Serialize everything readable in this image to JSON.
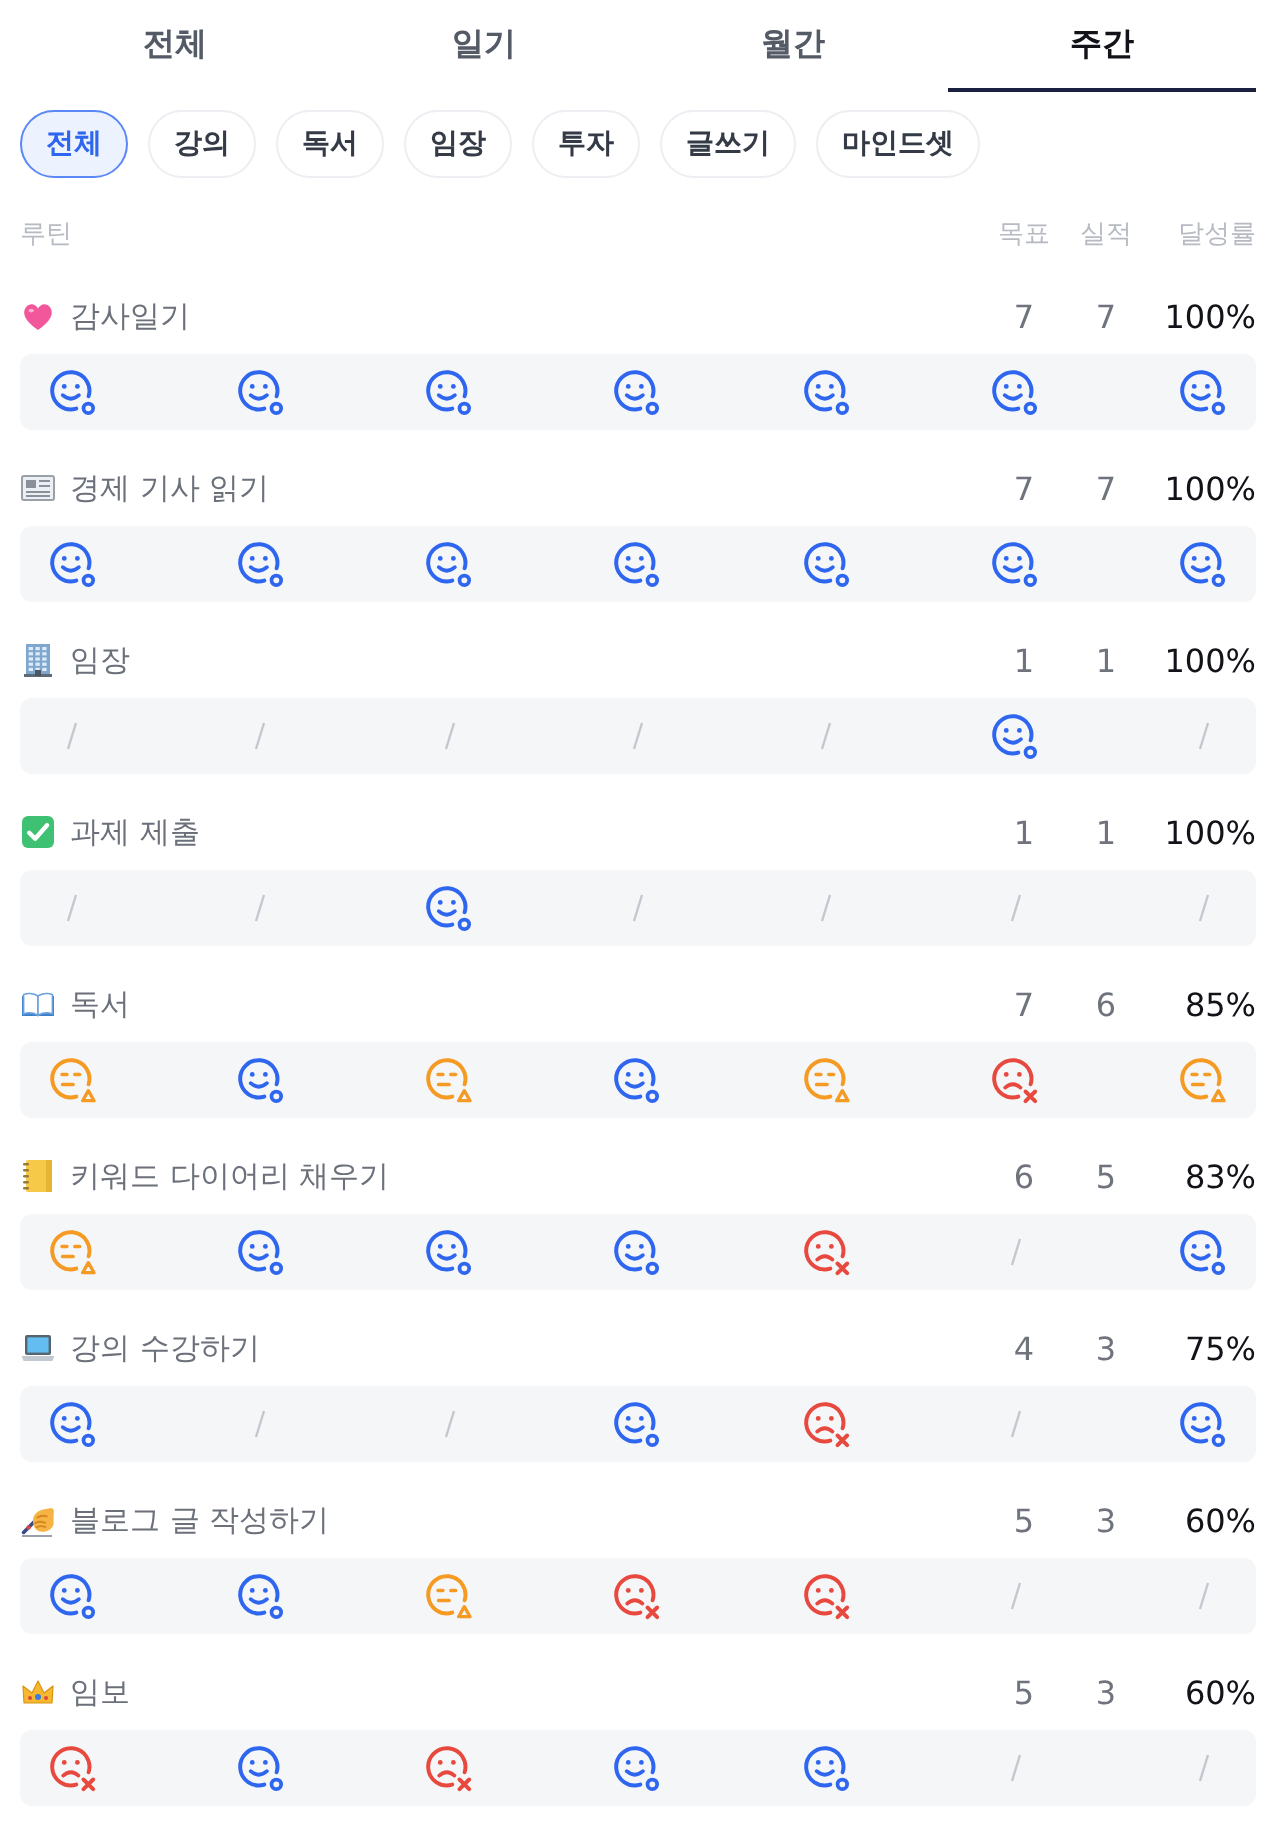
{
  "tabs": [
    {
      "label": "전체",
      "selected": false
    },
    {
      "label": "일기",
      "selected": false
    },
    {
      "label": "월간",
      "selected": false
    },
    {
      "label": "주간",
      "selected": true
    }
  ],
  "filters": [
    {
      "label": "전체",
      "selected": true
    },
    {
      "label": "강의",
      "selected": false
    },
    {
      "label": "독서",
      "selected": false
    },
    {
      "label": "임장",
      "selected": false
    },
    {
      "label": "투자",
      "selected": false
    },
    {
      "label": "글쓰기",
      "selected": false
    },
    {
      "label": "마인드셋",
      "selected": false
    }
  ],
  "table": {
    "columns": [
      "루틴",
      "목표",
      "실적",
      "달성률"
    ],
    "rows": [
      {
        "name": "감사일기",
        "goal": "7",
        "actual": "7",
        "rate": "100%",
        "days": [
          {
            "kind": "done"
          },
          {
            "kind": "done"
          },
          {
            "kind": "done"
          },
          {
            "kind": "done"
          },
          {
            "kind": "done"
          },
          {
            "kind": "done"
          },
          {
            "kind": "done"
          }
        ]
      },
      {
        "name": "경제 기사 읽기",
        "goal": "7",
        "actual": "7",
        "rate": "100%",
        "days": [
          {
            "kind": "done"
          },
          {
            "kind": "done"
          },
          {
            "kind": "done"
          },
          {
            "kind": "done"
          },
          {
            "kind": "done"
          },
          {
            "kind": "done"
          },
          {
            "kind": "done"
          }
        ]
      },
      {
        "name": "임장",
        "goal": "1",
        "actual": "1",
        "rate": "100%",
        "days": [
          {
            "kind": "none"
          },
          {
            "kind": "none"
          },
          {
            "kind": "none"
          },
          {
            "kind": "none"
          },
          {
            "kind": "none"
          },
          {
            "kind": "done"
          },
          {
            "kind": "none"
          }
        ]
      },
      {
        "name": "과제 제출",
        "goal": "1",
        "actual": "1",
        "rate": "100%",
        "days": [
          {
            "kind": "none"
          },
          {
            "kind": "none"
          },
          {
            "kind": "done"
          },
          {
            "kind": "none"
          },
          {
            "kind": "none"
          },
          {
            "kind": "none"
          },
          {
            "kind": "none"
          }
        ]
      },
      {
        "name": "독서",
        "goal": "7",
        "actual": "6",
        "rate": "85%",
        "days": [
          {
            "kind": "partial"
          },
          {
            "kind": "done"
          },
          {
            "kind": "partial"
          },
          {
            "kind": "done"
          },
          {
            "kind": "partial"
          },
          {
            "kind": "missed"
          },
          {
            "kind": "partial"
          }
        ]
      },
      {
        "name": "키워드 다이어리 채우기",
        "goal": "6",
        "actual": "5",
        "rate": "83%",
        "days": [
          {
            "kind": "partial"
          },
          {
            "kind": "done"
          },
          {
            "kind": "done"
          },
          {
            "kind": "done"
          },
          {
            "kind": "missed"
          },
          {
            "kind": "none"
          },
          {
            "kind": "done"
          }
        ]
      },
      {
        "name": "강의 수강하기",
        "goal": "4",
        "actual": "3",
        "rate": "75%",
        "days": [
          {
            "kind": "done"
          },
          {
            "kind": "none"
          },
          {
            "kind": "none"
          },
          {
            "kind": "done"
          },
          {
            "kind": "missed"
          },
          {
            "kind": "none"
          },
          {
            "kind": "done"
          }
        ]
      },
      {
        "name": "블로그 글 작성하기",
        "goal": "5",
        "actual": "3",
        "rate": "60%",
        "days": [
          {
            "kind": "done"
          },
          {
            "kind": "done"
          },
          {
            "kind": "partial"
          },
          {
            "kind": "missed"
          },
          {
            "kind": "missed"
          },
          {
            "kind": "none"
          },
          {
            "kind": "none"
          }
        ]
      },
      {
        "name": "임보",
        "goal": "5",
        "actual": "3",
        "rate": "60%",
        "days": [
          {
            "kind": "missed"
          },
          {
            "kind": "done"
          },
          {
            "kind": "missed"
          },
          {
            "kind": "done"
          },
          {
            "kind": "done"
          },
          {
            "kind": "none"
          },
          {
            "kind": "none"
          }
        ]
      }
    ]
  }
}
